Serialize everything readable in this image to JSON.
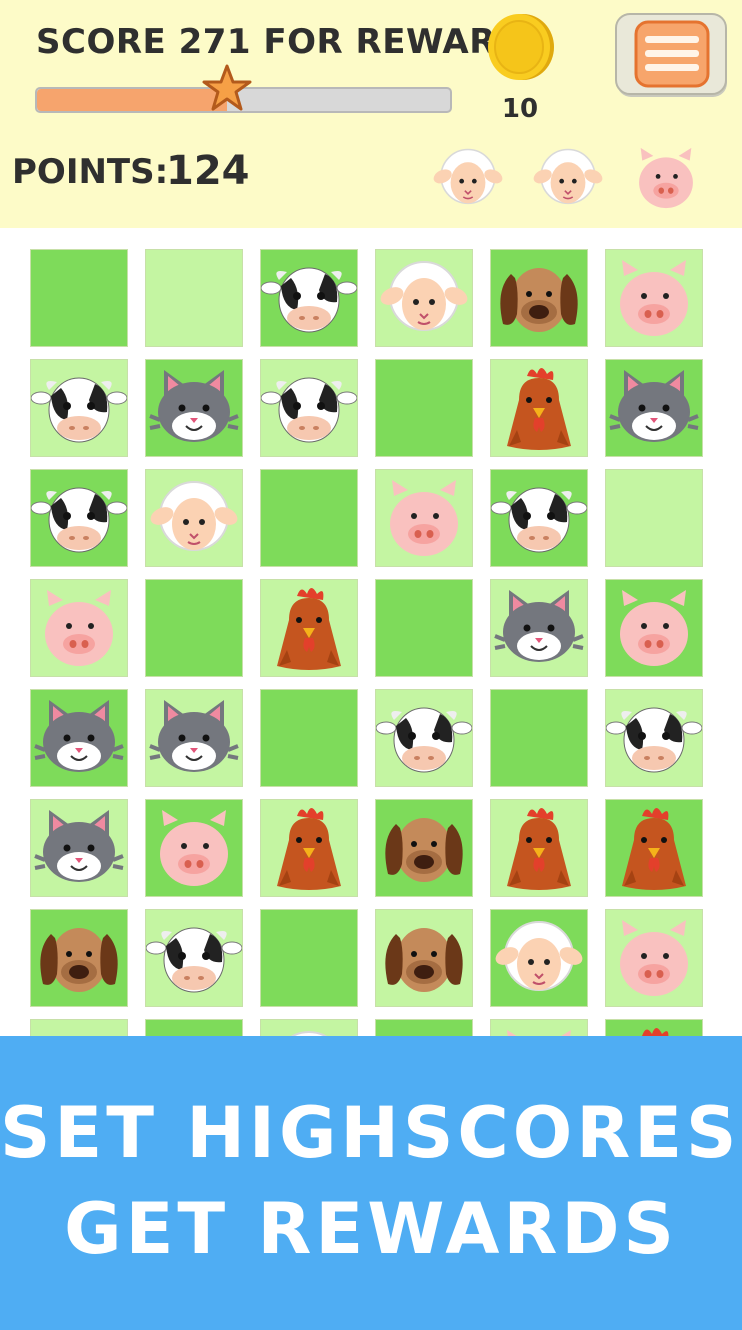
{
  "header": {
    "reward_label": "SCORE 271 FOR REWARD",
    "reward_progress_fraction": 0.46,
    "coin_count": "10",
    "points_label": "POINTS:",
    "points_value": "124",
    "goal_animals": [
      "sheep",
      "sheep",
      "pig"
    ]
  },
  "colors": {
    "header_bg": "#fdfbc8",
    "progress_fill": "#f6a46d",
    "tile_dark": "#7edb5a",
    "tile_light": "#c4f5a2",
    "banner_bg": "#4fadf3"
  },
  "board": {
    "rows": [
      [
        {
          "bg": "dark",
          "animal": null
        },
        {
          "bg": "light",
          "animal": null
        },
        {
          "bg": "dark",
          "animal": "cow"
        },
        {
          "bg": "light",
          "animal": "sheep"
        },
        {
          "bg": "dark",
          "animal": "dog"
        },
        {
          "bg": "light",
          "animal": "pig"
        }
      ],
      [
        {
          "bg": "light",
          "animal": "cow"
        },
        {
          "bg": "dark",
          "animal": "cat"
        },
        {
          "bg": "light",
          "animal": "cow"
        },
        {
          "bg": "dark",
          "animal": null
        },
        {
          "bg": "light",
          "animal": "chicken"
        },
        {
          "bg": "dark",
          "animal": "cat"
        }
      ],
      [
        {
          "bg": "dark",
          "animal": "cow"
        },
        {
          "bg": "light",
          "animal": "sheep"
        },
        {
          "bg": "dark",
          "animal": null
        },
        {
          "bg": "light",
          "animal": "pig"
        },
        {
          "bg": "dark",
          "animal": "cow"
        },
        {
          "bg": "light",
          "animal": null
        }
      ],
      [
        {
          "bg": "light",
          "animal": "pig"
        },
        {
          "bg": "dark",
          "animal": null
        },
        {
          "bg": "light",
          "animal": "chicken"
        },
        {
          "bg": "dark",
          "animal": null
        },
        {
          "bg": "light",
          "animal": "cat"
        },
        {
          "bg": "dark",
          "animal": "pig"
        }
      ],
      [
        {
          "bg": "dark",
          "animal": "cat"
        },
        {
          "bg": "light",
          "animal": "cat"
        },
        {
          "bg": "dark",
          "animal": null
        },
        {
          "bg": "light",
          "animal": "cow"
        },
        {
          "bg": "dark",
          "animal": null
        },
        {
          "bg": "light",
          "animal": "cow"
        }
      ],
      [
        {
          "bg": "light",
          "animal": "cat"
        },
        {
          "bg": "dark",
          "animal": "pig"
        },
        {
          "bg": "light",
          "animal": "chicken"
        },
        {
          "bg": "dark",
          "animal": "dog"
        },
        {
          "bg": "light",
          "animal": "chicken"
        },
        {
          "bg": "dark",
          "animal": "chicken"
        }
      ],
      [
        {
          "bg": "dark",
          "animal": "dog"
        },
        {
          "bg": "light",
          "animal": "cow"
        },
        {
          "bg": "dark",
          "animal": null
        },
        {
          "bg": "light",
          "animal": "dog"
        },
        {
          "bg": "dark",
          "animal": "sheep"
        },
        {
          "bg": "light",
          "animal": "pig"
        }
      ],
      [
        {
          "bg": "light",
          "animal": null
        },
        {
          "bg": "dark",
          "animal": null
        },
        {
          "bg": "light",
          "animal": "sheep"
        },
        {
          "bg": "dark",
          "animal": "dog"
        },
        {
          "bg": "light",
          "animal": "pig"
        },
        {
          "bg": "dark",
          "animal": "chicken"
        }
      ]
    ]
  },
  "banner": {
    "line1": "SET HIGHSCORES,",
    "line2": "GET REWARDS"
  }
}
